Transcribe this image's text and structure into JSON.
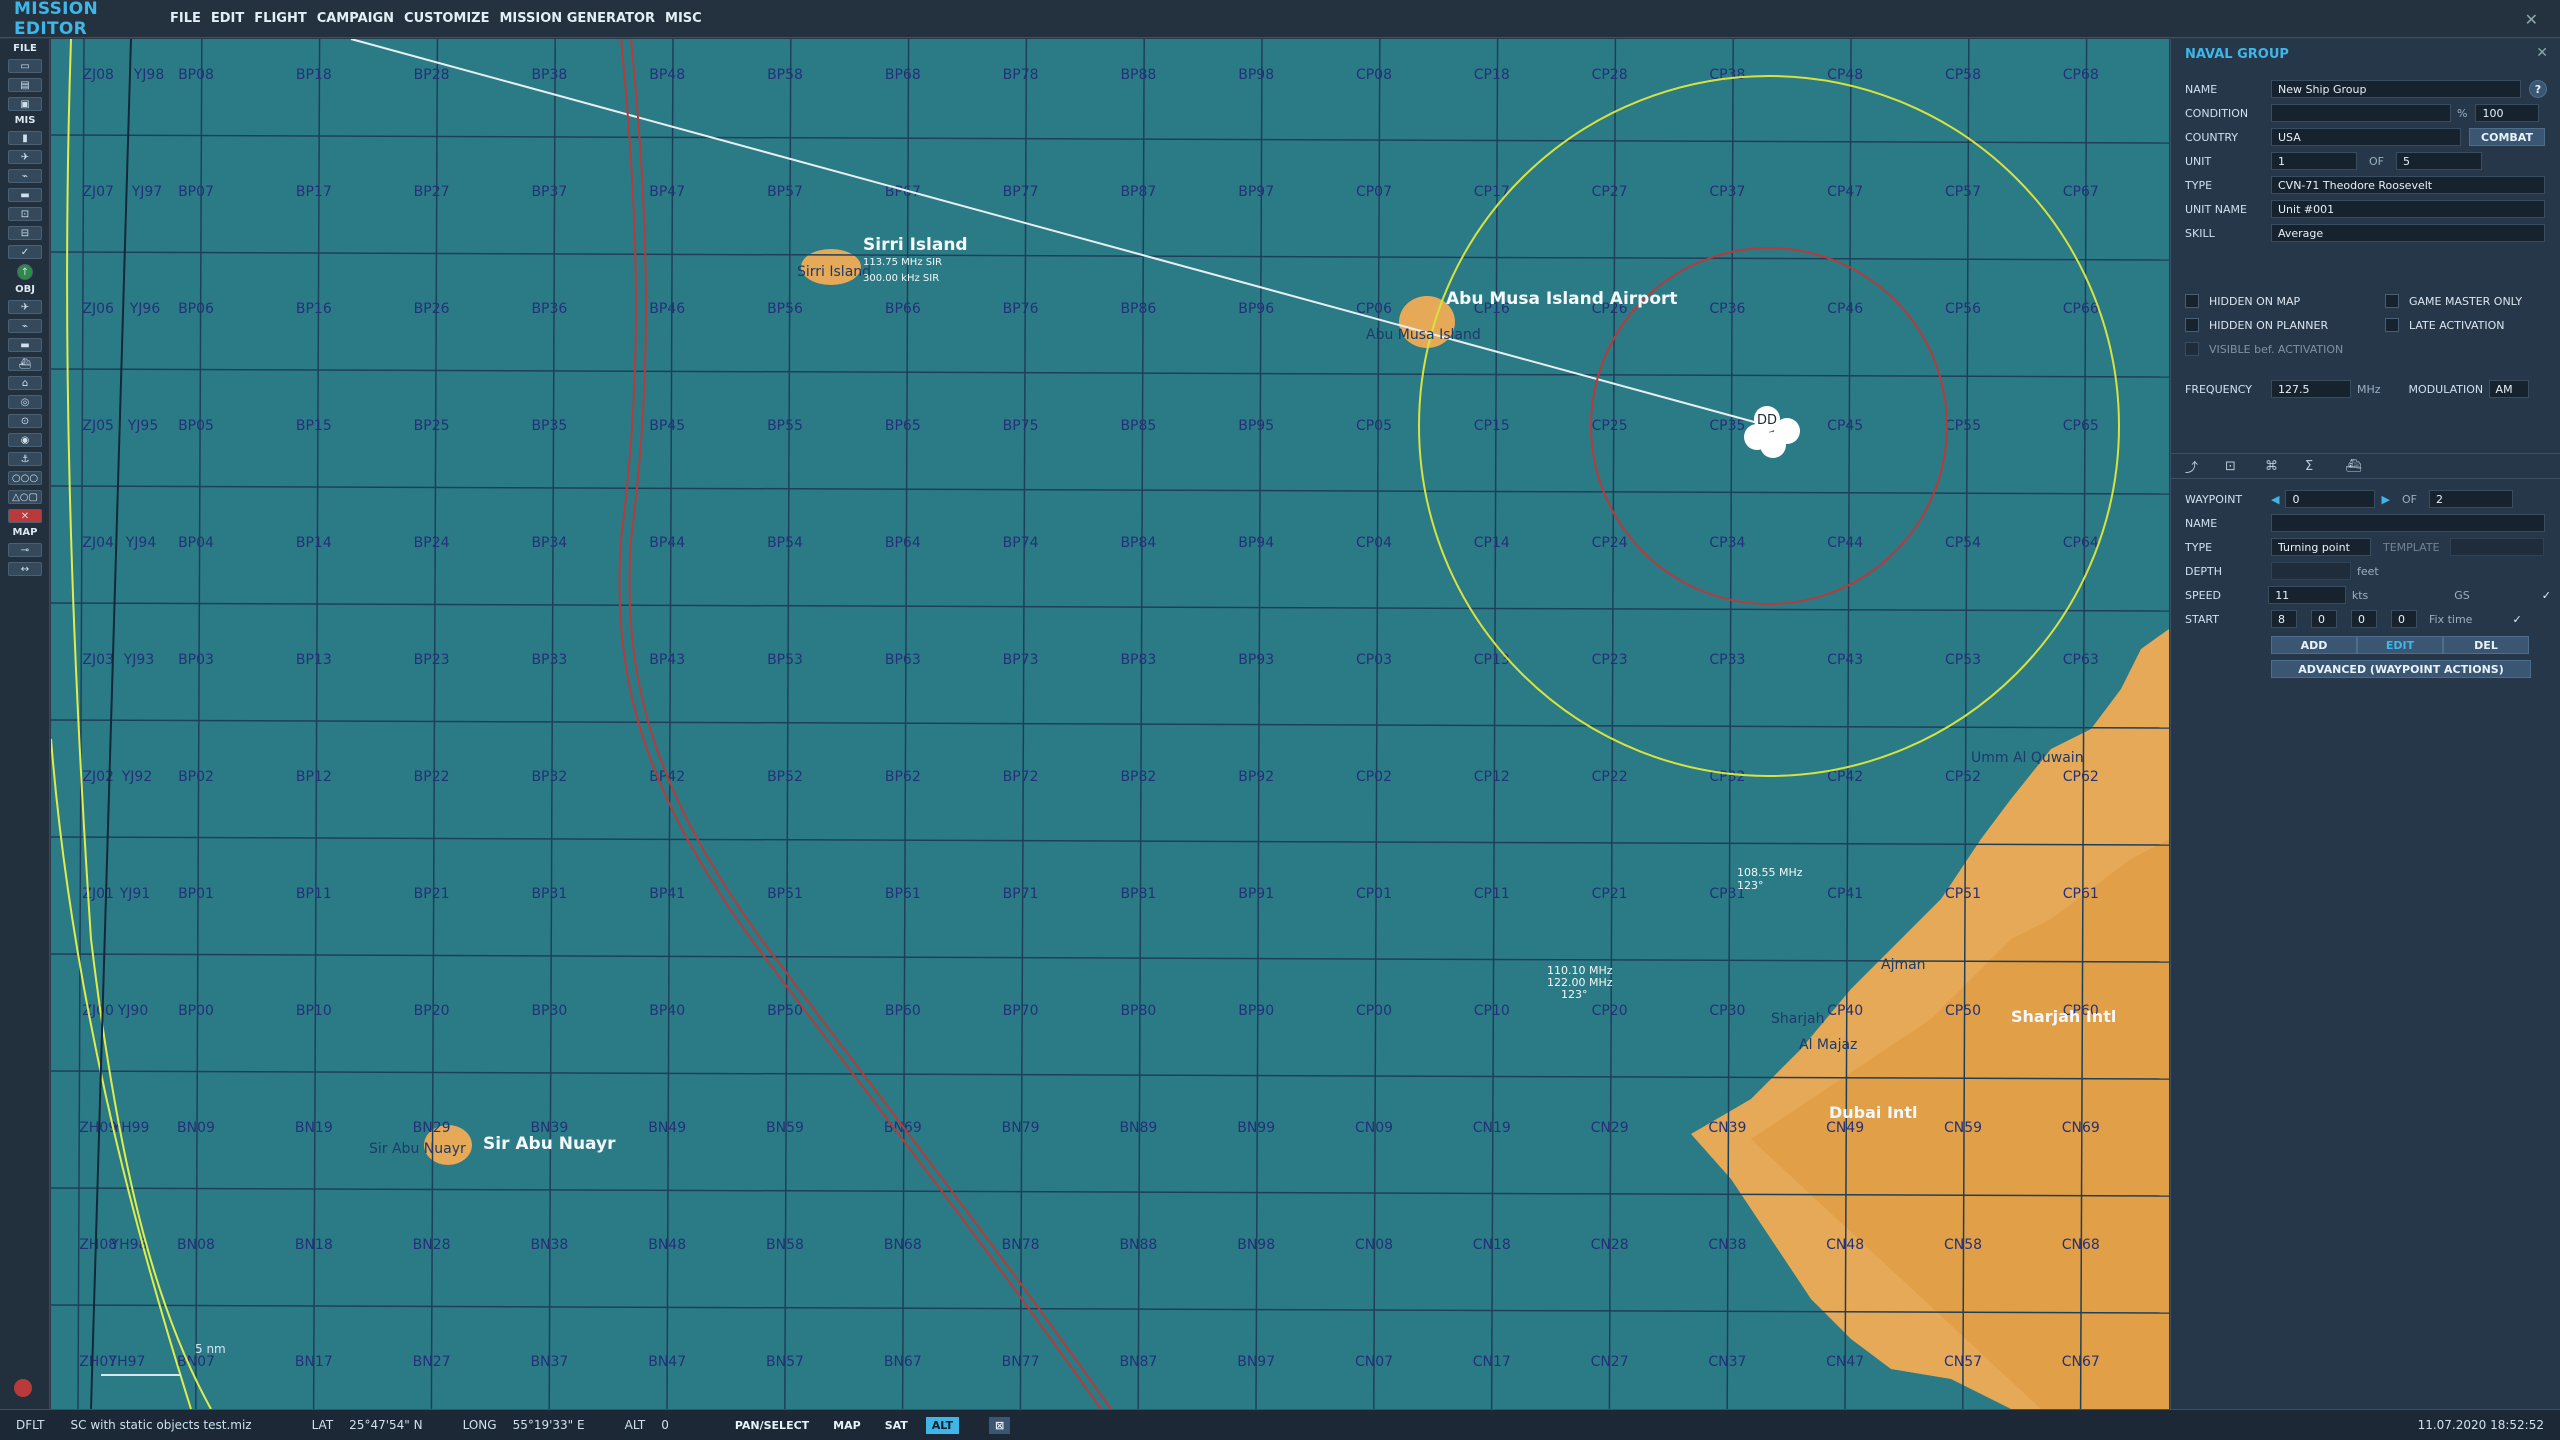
{
  "app": {
    "title": "MISSION EDITOR",
    "menu": [
      "FILE",
      "EDIT",
      "FLIGHT",
      "CAMPAIGN",
      "CUSTOMIZE",
      "MISSION GENERATOR",
      "MISC"
    ],
    "close_icon": "close-icon"
  },
  "toolbar": {
    "sections": {
      "file": "FILE",
      "mis": "MIS",
      "obj": "OBJ",
      "map": "MAP"
    }
  },
  "map": {
    "places": [
      {
        "name": "Sirri Island",
        "sub": "Sirri Island"
      },
      {
        "name": "Abu Musa Island Airport",
        "sub": "Abu Musa Island"
      },
      {
        "name": "Sir Abu Nuayr",
        "sub": "Sir Abu Nuayr"
      },
      {
        "name": "Dubai Intl"
      },
      {
        "name": "Sharjah Intl"
      },
      {
        "name": "Umm Al Quwain"
      },
      {
        "name": "Ajman"
      },
      {
        "name": "Sharjah"
      },
      {
        "name": "Al Majaz"
      }
    ],
    "nav_labels": [
      "108.55 MHz",
      "123°",
      "110.10 MHz",
      "122.00 MHz",
      "123°",
      "113.75 MHz SIR",
      "300.00 kHz SIR"
    ],
    "scale": "5 nm",
    "group_marker": "DD",
    "col_labels_top": [
      "BP08",
      "BP18",
      "BP28",
      "BP38",
      "BP48",
      "BP58",
      "BP68",
      "BP78",
      "BP88",
      "BP98",
      "CP08",
      "CP18",
      "CP28",
      "CP38",
      "CP48",
      "CP58",
      "CP68"
    ],
    "row_prefixes_left": [
      "YJ98",
      "YJ97",
      "YJ96",
      "YJ95",
      "YJ94",
      "YJ93",
      "YJ92",
      "YJ91",
      "YJ90",
      "YH99",
      "YH98",
      "YH97"
    ],
    "grid_rows": [
      [
        "ZJ08",
        "BP08",
        "BP18",
        "BP28",
        "BP38",
        "BP48",
        "BP58",
        "BP68",
        "BP78",
        "BP88",
        "BP98",
        "CP08",
        "CP18",
        "CP28",
        "CP38",
        "CP48",
        "CP58",
        "CP68"
      ],
      [
        "ZJ07",
        "BP07",
        "BP17",
        "BP27",
        "BP37",
        "BP47",
        "BP57",
        "BP67",
        "BP77",
        "BP87",
        "BP97",
        "CP07",
        "CP17",
        "CP27",
        "CP37",
        "CP47",
        "CP57",
        "CP67"
      ],
      [
        "ZJ06",
        "BP06",
        "BP16",
        "BP26",
        "BP36",
        "BP46",
        "BP56",
        "BP66",
        "BP76",
        "BP86",
        "BP96",
        "CP06",
        "CP16",
        "CP26",
        "CP36",
        "CP46",
        "CP56",
        "CP66"
      ],
      [
        "ZJ05",
        "BP05",
        "BP15",
        "BP25",
        "BP35",
        "BP45",
        "BP55",
        "BP65",
        "BP75",
        "BP85",
        "BP95",
        "CP05",
        "CP15",
        "CP25",
        "CP35",
        "CP45",
        "CP55",
        "CP65"
      ],
      [
        "ZJ04",
        "BP04",
        "BP14",
        "BP24",
        "BP34",
        "BP44",
        "BP54",
        "BP64",
        "BP74",
        "BP84",
        "BP94",
        "CP04",
        "CP14",
        "CP24",
        "CP34",
        "CP44",
        "CP54",
        "CP64"
      ],
      [
        "ZJ03",
        "BP03",
        "BP13",
        "BP23",
        "BP33",
        "BP43",
        "BP53",
        "BP63",
        "BP73",
        "BP83",
        "BP93",
        "CP03",
        "CP13",
        "CP23",
        "CP33",
        "CP43",
        "CP53",
        "CP63"
      ],
      [
        "ZJ02",
        "BP02",
        "BP12",
        "BP22",
        "BP32",
        "BP42",
        "BP52",
        "BP62",
        "BP72",
        "BP82",
        "BP92",
        "CP02",
        "CP12",
        "CP22",
        "CP32",
        "CP42",
        "CP52",
        "CP62"
      ],
      [
        "ZJ01",
        "BP01",
        "BP11",
        "BP21",
        "BP31",
        "BP41",
        "BP51",
        "BP61",
        "BP71",
        "BP81",
        "BP91",
        "CP01",
        "CP11",
        "CP21",
        "CP31",
        "CP41",
        "CP51",
        "CP61"
      ],
      [
        "ZJ00",
        "BP00",
        "BP10",
        "BP20",
        "BP30",
        "BP40",
        "BP50",
        "BP60",
        "BP70",
        "BP80",
        "BP90",
        "CP00",
        "CP10",
        "CP20",
        "CP30",
        "CP40",
        "CP50",
        "CP60"
      ],
      [
        "ZH09",
        "BN09",
        "BN19",
        "BN29",
        "BN39",
        "BN49",
        "BN59",
        "BN69",
        "BN79",
        "BN89",
        "BN99",
        "CN09",
        "CN19",
        "CN29",
        "CN39",
        "CN49",
        "CN59",
        "CN69"
      ],
      [
        "ZH08",
        "BN08",
        "BN18",
        "BN28",
        "BN38",
        "BN48",
        "BN58",
        "BN68",
        "BN78",
        "BN88",
        "BN98",
        "CN08",
        "CN18",
        "CN28",
        "CN38",
        "CN48",
        "CN58",
        "CN68"
      ],
      [
        "ZH07",
        "BN07",
        "BN17",
        "BN27",
        "BN37",
        "BN47",
        "BN57",
        "BN67",
        "BN77",
        "BN87",
        "BN97",
        "CN07",
        "CN17",
        "CN27",
        "CN37",
        "CN47",
        "CN57",
        "CN67"
      ]
    ]
  },
  "panel": {
    "title": "NAVAL GROUP",
    "name_label": "NAME",
    "name_value": "New Ship Group",
    "help": "?",
    "condition_label": "CONDITION",
    "condition_pct": "%",
    "condition_value": "100",
    "country_label": "COUNTRY",
    "country_value": "USA",
    "combat_button": "COMBAT",
    "unit_label": "UNIT",
    "unit_value": "1",
    "unit_of": "OF",
    "unit_total": "5",
    "type_label": "TYPE",
    "type_value": "CVN-71 Theodore Roosevelt",
    "unit_name_label": "UNIT NAME",
    "unit_name_value": "Unit #001",
    "skill_label": "SKILL",
    "skill_value": "Average",
    "hidden_on_map": "HIDDEN ON MAP",
    "game_master_only": "GAME MASTER ONLY",
    "hidden_on_planner": "HIDDEN ON PLANNER",
    "late_activation": "LATE ACTIVATION",
    "visible_bef_activation": "VISIBLE bef. ACTIVATION",
    "frequency_label": "FREQUENCY",
    "frequency_value": "127.5",
    "frequency_unit": "MHz",
    "modulation_label": "MODULATION",
    "modulation_value": "AM",
    "waypoint_label": "WAYPOINT",
    "waypoint_value": "0",
    "waypoint_of": "OF",
    "waypoint_total": "2",
    "wp_name_label": "NAME",
    "wp_name_value": "",
    "wp_type_label": "TYPE",
    "wp_type_value": "Turning point",
    "template_label": "TEMPLATE",
    "depth_label": "DEPTH",
    "depth_unit": "feet",
    "speed_label": "SPEED",
    "speed_value": "11",
    "speed_unit": "kts",
    "gs_label": "GS",
    "start_label": "START",
    "start_d": "8",
    "start_h": "0",
    "start_m": "0",
    "start_s": "0",
    "fix_time": "Fix time",
    "add_button": "ADD",
    "edit_button": "EDIT",
    "del_button": "DEL",
    "advanced_button": "ADVANCED (WAYPOINT ACTIONS)"
  },
  "status": {
    "profile": "DFLT",
    "file": "SC with static objects test.miz",
    "lat_label": "LAT",
    "lat_value": "25°47'54\" N",
    "long_label": "LONG",
    "long_value": "55°19'33\" E",
    "alt_label": "ALT",
    "alt_value": "0",
    "pan_select": "PAN/SELECT",
    "map_btn": "MAP",
    "sat_btn": "SAT",
    "alt_btn": "ALT",
    "datetime": "11.07.2020 18:52:52"
  },
  "colors": {
    "sea": "#2b7b86",
    "land": "#e6a957",
    "accent": "#3fb6e8",
    "panel": "#27374a",
    "grid": "#1f3f59",
    "yellow_circle": "#d8e23e",
    "red_circle": "#b93a3a"
  }
}
